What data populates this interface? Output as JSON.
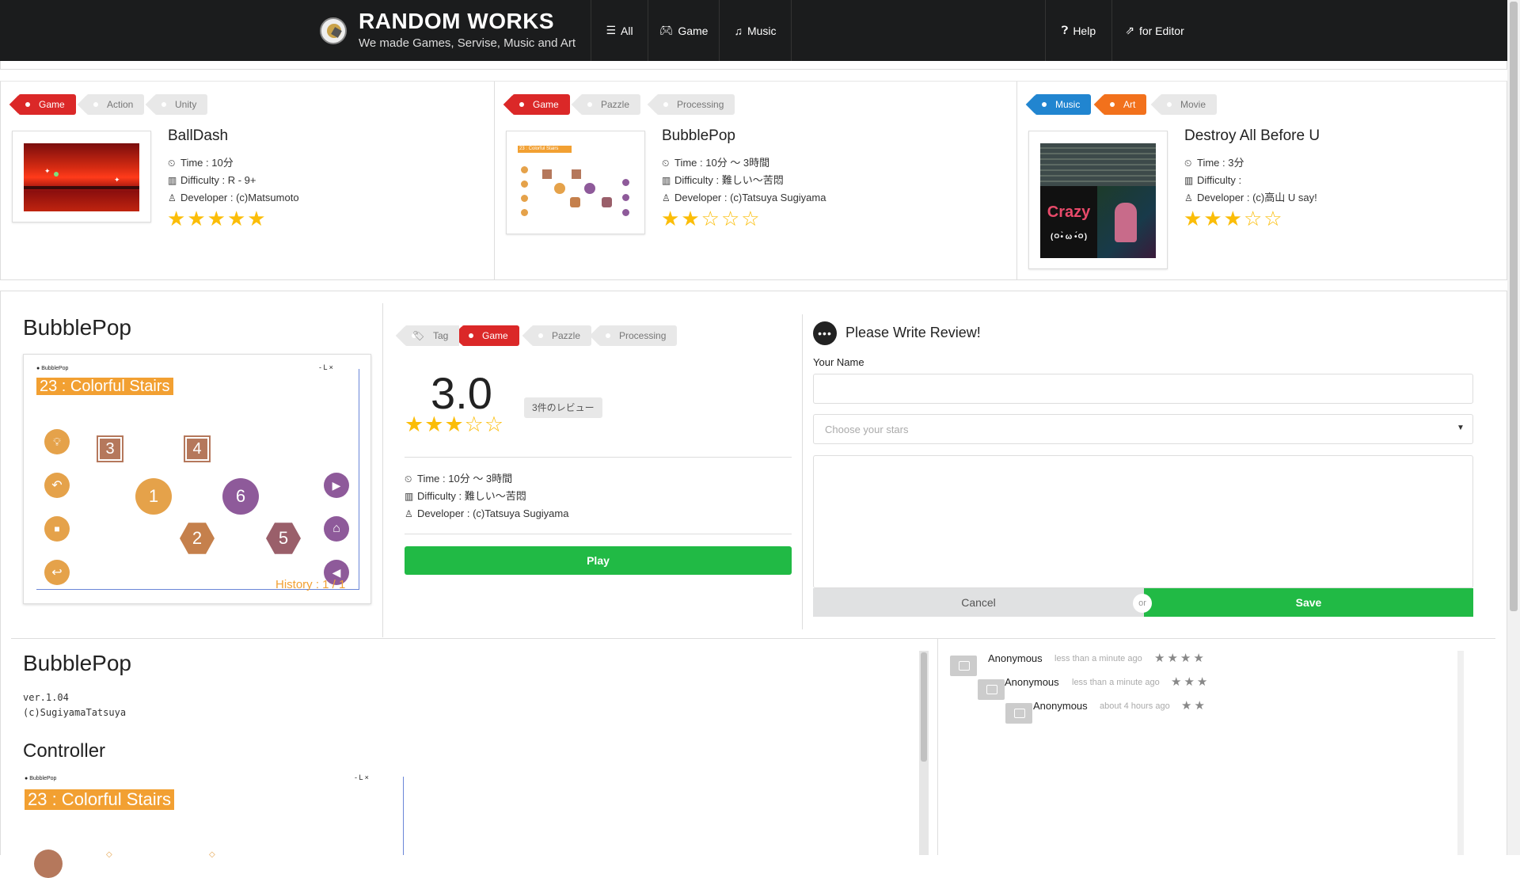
{
  "header": {
    "brand_title": "RANDOM WORKS",
    "brand_subtitle": "We made Games, Servise, Music and Art",
    "nav": [
      {
        "label": "All",
        "icon": "list-icon"
      },
      {
        "label": "Game",
        "icon": "gamepad-icon"
      },
      {
        "label": "Music",
        "icon": "music-icon"
      },
      {
        "label": "Help",
        "icon": "question-circle-icon"
      },
      {
        "label": "for Editor",
        "icon": "external-link-icon"
      }
    ]
  },
  "cards": [
    {
      "tags": [
        "Game",
        "Action",
        "Unity"
      ],
      "title": "BallDash",
      "time": "Time : 10分",
      "difficulty": "Difficulty : R - 9+",
      "developer": "Developer : (c)Matsumoto",
      "rating": 5
    },
    {
      "tags": [
        "Game",
        "Pazzle",
        "Processing"
      ],
      "title": "BubblePop",
      "time": "Time : 10分 〜 3時間",
      "difficulty": "Difficulty : 難しい〜苦悶",
      "developer": "Developer : (c)Tatsuya Sugiyama",
      "rating": 2
    },
    {
      "tags": [
        "Music",
        "Art",
        "Movie"
      ],
      "title": "Destroy All Before U",
      "time": "Time : 3分",
      "difficulty": "Difficulty : ",
      "developer": "Developer : (c)高山 U say!",
      "rating": 3,
      "thumb_text": "Crazy",
      "thumb_face": "(ㅇ•̀ ω •́ㅇ)"
    }
  ],
  "detail": {
    "title": "BubblePop",
    "game_header": "23 : Colorful Stairs",
    "game_small_title": "BubblePop",
    "game_window_controls": "-  L  ×",
    "history": "History : 1 / 1",
    "hex_numbers": [
      "3",
      "4",
      "1",
      "6",
      "2",
      "5"
    ],
    "tags": [
      "Tag",
      "Game",
      "Pazzle",
      "Processing"
    ],
    "score": "3.0",
    "rating": 3,
    "review_count": "3件のレビュー",
    "time": "Time : 10分 〜 3時間",
    "difficulty": "Difficulty : 難しい〜苦悶",
    "developer": "Developer : (c)Tatsuya Sugiyama",
    "play_label": "Play"
  },
  "review_form": {
    "heading": "Please Write Review!",
    "name_label": "Your Name",
    "name_value": "",
    "stars_placeholder": "Choose your stars",
    "cancel_label": "Cancel",
    "or_label": "or",
    "save_label": "Save"
  },
  "info": {
    "title": "BubblePop",
    "version": "ver.1.04",
    "copyright": "(c)SugiyamaTatsuya",
    "controller_title": "Controller",
    "controller_game_header": "23 : Colorful Stairs",
    "controller_small_title": "BubblePop",
    "controller_window_controls": "-  L  ×"
  },
  "comments": [
    {
      "author": "Anonymous",
      "time": "less than a minute ago",
      "stars": 4
    },
    {
      "author": "Anonymous",
      "time": "less than a minute ago",
      "stars": 3
    },
    {
      "author": "Anonymous",
      "time": "about 4 hours ago",
      "stars": 2
    }
  ],
  "colors": {
    "navbar": "#1b1c1d",
    "red_tag": "#db2828",
    "blue_tag": "#2185d0",
    "orange_tag": "#f2711c",
    "green": "#21ba45",
    "star": "#fbbd08",
    "game_orange": "#e5a24a",
    "game_brown": "#b5785c",
    "game_purple": "#8e5a9a"
  }
}
